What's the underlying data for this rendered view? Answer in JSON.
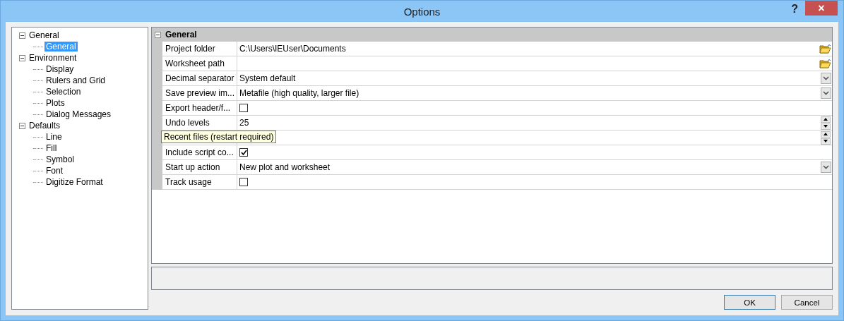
{
  "window": {
    "title": "Options",
    "help": "?",
    "close": "×"
  },
  "tree": [
    {
      "label": "General",
      "expanded": true,
      "selected": false,
      "children": [
        {
          "label": "General",
          "selected": true
        }
      ]
    },
    {
      "label": "Environment",
      "expanded": true,
      "selected": false,
      "children": [
        {
          "label": "Display",
          "selected": false
        },
        {
          "label": "Rulers and Grid",
          "selected": false
        },
        {
          "label": "Selection",
          "selected": false
        },
        {
          "label": "Plots",
          "selected": false
        },
        {
          "label": "Dialog Messages",
          "selected": false
        }
      ]
    },
    {
      "label": "Defaults",
      "expanded": true,
      "selected": false,
      "children": [
        {
          "label": "Line",
          "selected": false
        },
        {
          "label": "Fill",
          "selected": false
        },
        {
          "label": "Symbol",
          "selected": false
        },
        {
          "label": "Font",
          "selected": false
        },
        {
          "label": "Digitize Format",
          "selected": false
        }
      ]
    }
  ],
  "grid": {
    "category": "General",
    "expanded": true,
    "rows": [
      {
        "kind": "folder",
        "label": "Project folder",
        "value": "C:\\Users\\IEUser\\Documents"
      },
      {
        "kind": "folder",
        "label": "Worksheet path"
      },
      {
        "kind": "dropdown",
        "label": "Decimal separator",
        "value": "System default"
      },
      {
        "kind": "dropdown",
        "label": "Save preview im...",
        "value": "Metafile (high quality, larger file)"
      },
      {
        "kind": "checkbox",
        "label": "Export header/f...",
        "checked": false
      },
      {
        "kind": "spin",
        "label": "Undo levels",
        "value": "25"
      },
      {
        "kind": "spin",
        "tooltip": "Recent files (restart required)"
      },
      {
        "kind": "checkbox",
        "label": "Include script co...",
        "checked": true
      },
      {
        "kind": "plaindropdown",
        "label": "Start up action",
        "value": "New plot and worksheet"
      },
      {
        "kind": "checkbox",
        "label": "Track usage",
        "checked": false
      }
    ]
  },
  "buttons": [
    "OK",
    "Cancel"
  ]
}
